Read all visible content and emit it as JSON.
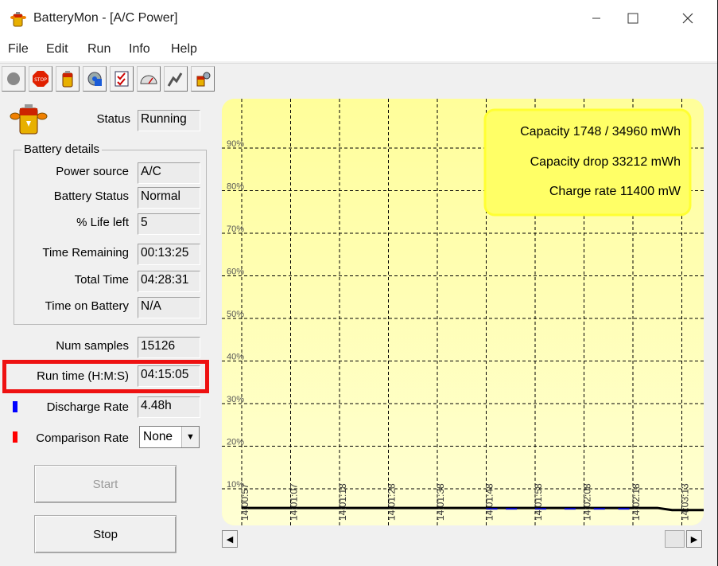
{
  "window": {
    "title": "BatteryMon - [A/C Power]"
  },
  "menu": [
    "File",
    "Edit",
    "Run",
    "Info",
    "Help"
  ],
  "toolbar": {
    "buttons": [
      "record-icon",
      "stop-icon",
      "battery-icon",
      "settings-icon",
      "checklist-icon",
      "gauge-icon",
      "graph-icon",
      "tools-icon"
    ]
  },
  "status": {
    "label": "Status",
    "value": "Running"
  },
  "battery_details": {
    "title": "Battery details",
    "power_source": {
      "label": "Power source",
      "value": "A/C"
    },
    "battery_status": {
      "label": "Battery Status",
      "value": "Normal"
    },
    "life_left": {
      "label": "% Life left",
      "value": "5"
    },
    "time_remaining": {
      "label": "Time Remaining",
      "value": "00:13:25"
    },
    "total_time": {
      "label": "Total Time",
      "value": "04:28:31"
    },
    "time_on_battery": {
      "label": "Time on Battery",
      "value": "N/A"
    }
  },
  "num_samples": {
    "label": "Num samples",
    "value": "15126"
  },
  "run_time": {
    "label": "Run time (H:M:S)",
    "value": "04:15:05"
  },
  "discharge_rate": {
    "label": "Discharge Rate",
    "value": "4.48h",
    "color": "#0000ff"
  },
  "comparison_rate": {
    "label": "Comparison Rate",
    "value": "None",
    "color": "#ff0000"
  },
  "buttons": {
    "start": "Start",
    "stop": "Stop"
  },
  "chart_info": {
    "capacity": "Capacity 1748 / 34960 mWh",
    "capacity_drop": "Capacity drop 33212 mWh",
    "charge_rate": "Charge rate 11400 mW"
  },
  "chart_data": {
    "type": "line",
    "y_ticks": [
      "10%",
      "20%",
      "30%",
      "40%",
      "50%",
      "60%",
      "70%",
      "80%",
      "90%"
    ],
    "x_ticks": [
      "14:00:57",
      "14:01:07",
      "14:01:18",
      "14:01:28",
      "14:01:38",
      "14:01:48",
      "14:01:58",
      "14:02:08",
      "14:02:18",
      "14:03:13"
    ],
    "ylim": [
      0,
      100
    ],
    "series": [
      {
        "color": "#000000",
        "x": [
          0,
          8.5,
          8.8,
          10
        ],
        "values": [
          5.5,
          5.5,
          5.0,
          5.0
        ]
      },
      {
        "color": "#0000cc",
        "x": [
          5.0,
          5.4,
          6.0,
          6.6,
          7.2,
          7.7
        ],
        "values": [
          5.3,
          5.3,
          5.3,
          5.3,
          5.3,
          5.3
        ]
      }
    ],
    "background": "#ffff99",
    "grid": true,
    "legend": "top-right"
  }
}
